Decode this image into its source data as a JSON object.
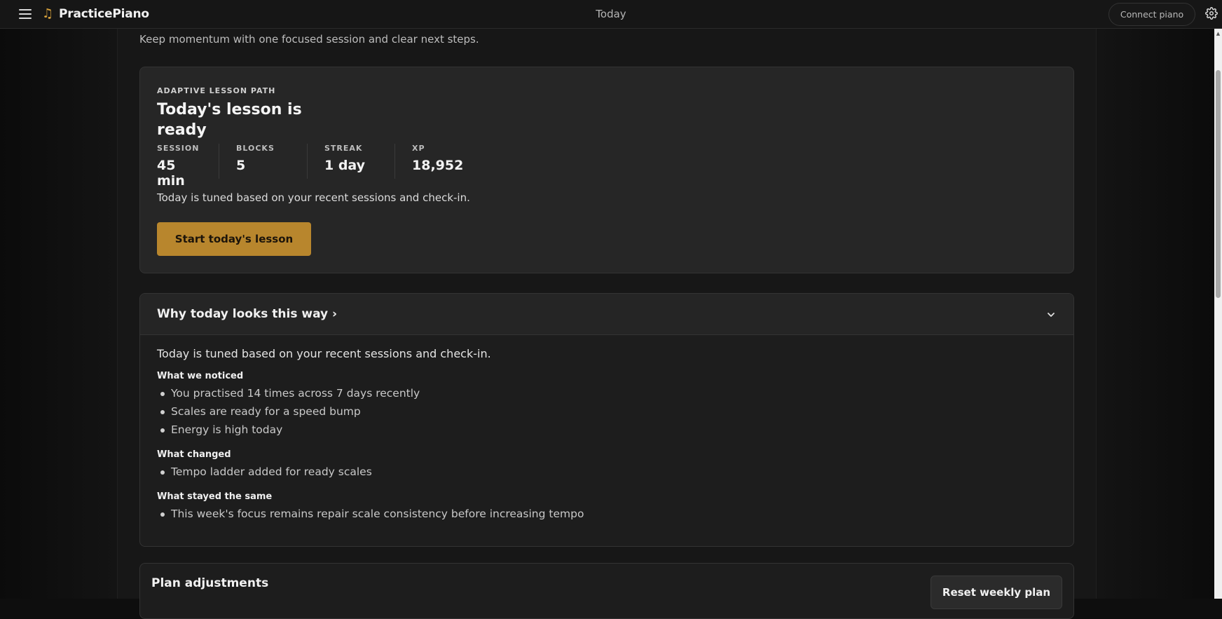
{
  "header": {
    "brand": "PracticePiano",
    "page_title": "Today",
    "connect_label": "Connect piano",
    "brand_color": "#d8a23c"
  },
  "intro": {
    "subtitle": "Keep momentum with one focused session and clear next steps."
  },
  "lesson": {
    "eyebrow": "ADAPTIVE LESSON PATH",
    "title": "Today's lesson is ready",
    "stats": [
      {
        "label": "SESSION",
        "value": "45 min"
      },
      {
        "label": "BLOCKS",
        "value": "5"
      },
      {
        "label": "STREAK",
        "value": "1 day"
      },
      {
        "label": "XP",
        "value": "18,952"
      }
    ],
    "note": "Today is tuned based on your recent sessions and check-in.",
    "cta_label": "Start today's lesson",
    "cta_color": "#b8862d"
  },
  "why": {
    "title": "Why today looks this way ›",
    "lead": "Today is tuned based on your recent sessions and check-in.",
    "sections": [
      {
        "heading": "What we noticed",
        "items": [
          "You practised 14 times across 7 days recently",
          "Scales are ready for a speed bump",
          "Energy is high today"
        ]
      },
      {
        "heading": "What changed",
        "items": [
          "Tempo ladder added for ready scales"
        ]
      },
      {
        "heading": "What stayed the same",
        "items": [
          "This week's focus remains repair scale consistency before increasing tempo"
        ]
      }
    ]
  },
  "plan": {
    "title": "Plan adjustments",
    "reset_label": "Reset weekly plan"
  },
  "icons": {
    "menu": "hamburger-icon",
    "logo": "music-note-icon",
    "settings": "gear-icon",
    "expand": "chevron-down-icon"
  }
}
